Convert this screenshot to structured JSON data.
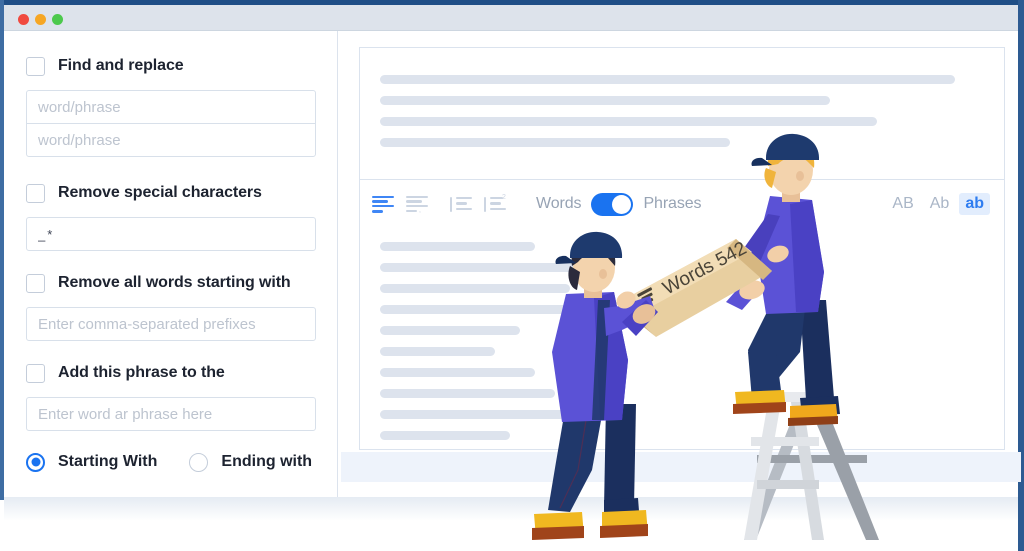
{
  "window": {
    "traffic_lights": [
      "close",
      "minimize",
      "maximize"
    ],
    "colors": {
      "close": "#f04a3f",
      "minimize": "#f6a623",
      "maximize": "#4cc94c",
      "accent": "#1a73f0",
      "titlebar": "#dde3eb",
      "frame": "#1f4e86"
    }
  },
  "sidebar": {
    "options": [
      {
        "id": "find-and-replace",
        "label": "Find and replace",
        "checked": false,
        "inputs": [
          {
            "id": "find-input",
            "placeholder": "word/phrase",
            "value": ""
          },
          {
            "id": "replace-input",
            "placeholder": "word/phrase",
            "value": ""
          }
        ]
      },
      {
        "id": "remove-special-characters",
        "label": "Remove special characters",
        "checked": false,
        "inputs": [
          {
            "id": "special-chars-input",
            "placeholder": "",
            "value": "_*"
          }
        ]
      },
      {
        "id": "remove-all-words-starting-with",
        "label": "Remove all words starting with",
        "checked": false,
        "inputs": [
          {
            "id": "prefixes-input",
            "placeholder": "Enter comma-separated prefixes",
            "value": ""
          }
        ]
      },
      {
        "id": "add-this-phrase-to-the",
        "label": "Add this phrase to the",
        "checked": false,
        "inputs": [
          {
            "id": "phrase-input",
            "placeholder": "Enter word ar phrase here",
            "value": ""
          }
        ]
      }
    ],
    "position_radios": [
      {
        "id": "starting-with",
        "label": "Starting With",
        "selected": true
      },
      {
        "id": "ending-with",
        "label": "Ending with",
        "selected": false
      }
    ]
  },
  "editor": {
    "toolbar": {
      "format_icons": [
        {
          "name": "align-left-icon",
          "active": true
        },
        {
          "name": "align-left-comma-icon",
          "active": false
        },
        {
          "name": "list-lines-icon",
          "active": false
        },
        {
          "name": "list-numbered-icon",
          "active": false
        }
      ],
      "toggle": {
        "left_label": "Words",
        "right_label": "Phrases",
        "state": "on"
      },
      "case_buttons": [
        {
          "label": "AB",
          "active": false
        },
        {
          "label": "Ab",
          "active": false
        },
        {
          "label": "ab",
          "active": true
        }
      ]
    },
    "top_panel_lines": [
      575,
      450,
      497,
      350
    ],
    "bottom_panel_lines": [
      155,
      210,
      190,
      215,
      140,
      115,
      155,
      175,
      190,
      130
    ]
  },
  "illustration": {
    "package_label": "Words 542",
    "package_icon": "stack-icon",
    "workers": [
      {
        "id": "worker-left",
        "hair": "#2b2b3c",
        "cap": "#1e3a6e",
        "jacket": "#5b52d6",
        "pants": "#20386b",
        "boots": "#f0a81c"
      },
      {
        "id": "worker-right",
        "hair": "#f0b43c",
        "cap": "#1e3a6e",
        "jacket": "#5b52d6",
        "pants": "#20386b",
        "boots": "#f0a81c"
      }
    ],
    "ladder": {
      "front": "#e2e5e9",
      "back": "#9aa0a8"
    },
    "box": {
      "face": "#e8cfa0",
      "top": "#f2ddb6",
      "side": "#d6b781"
    }
  }
}
